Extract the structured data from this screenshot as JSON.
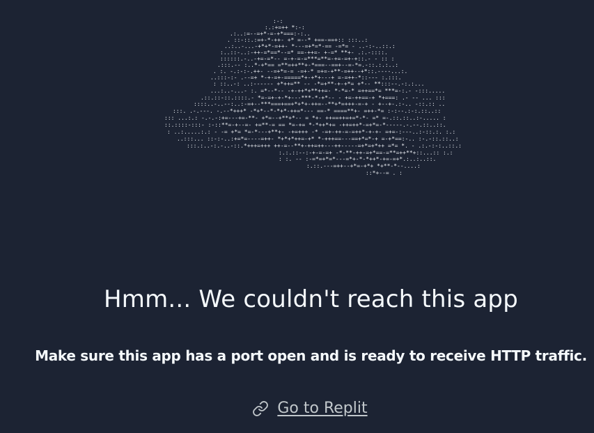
{
  "error": {
    "heading": "Hmm... We couldn't reach this app",
    "message": "Make sure this app has a port open and is ready to receive HTTP traffic."
  },
  "link": {
    "label": "Go to Replit",
    "icon": "link-icon"
  },
  "illustration": {
    "icon": "ascii-cloud-art"
  },
  "colors": {
    "background": "#1c2333",
    "text": "#f5f9fc",
    "link": "#c2c8cc",
    "ascii": "#e6e9ee"
  }
}
